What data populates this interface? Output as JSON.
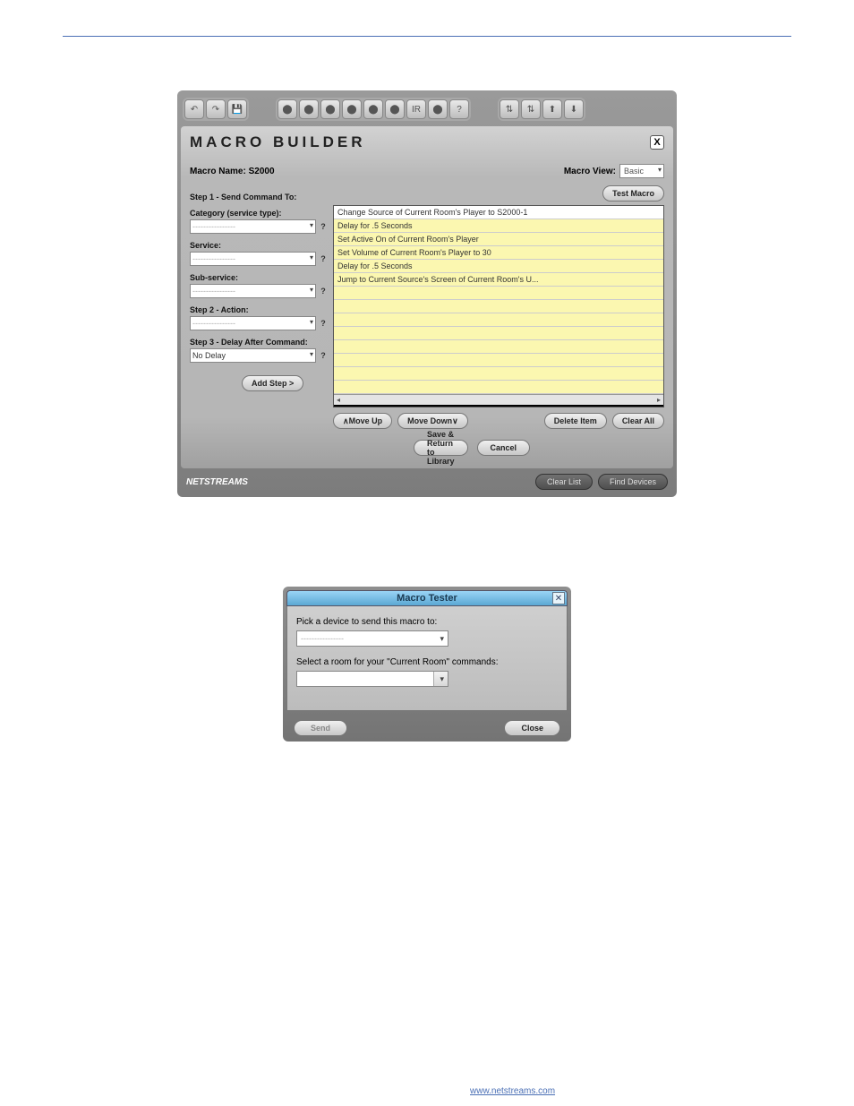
{
  "macro_builder": {
    "title": "MACRO BUILDER",
    "macro_name_label": "Macro Name:",
    "macro_name_value": "S2000",
    "macro_view_label": "Macro View:",
    "macro_view_value": "Basic",
    "test_macro": "Test Macro",
    "step1_label": "Step 1 - Send Command To:",
    "category_label": "Category (service type):",
    "service_label": "Service:",
    "subservice_label": "Sub-service:",
    "step2_label": "Step 2 - Action:",
    "step3_label": "Step 3 - Delay After Command:",
    "delay_value": "No Delay",
    "placeholder": "----------------",
    "add_step": "Add Step  >",
    "steps": [
      "Change Source of Current Room's Player to S2000-1",
      "Delay for .5 Seconds",
      "Set Active On of Current Room's Player",
      "Set Volume of Current Room's Player to 30",
      "Delay for .5 Seconds",
      "Jump to Current Source's Screen of Current Room's U..."
    ],
    "move_up": "Move Up",
    "move_down": "Move Down",
    "delete_item": "Delete Item",
    "clear_all": "Clear All",
    "save_return": "Save & Return to Library",
    "cancel": "Cancel",
    "clear_list": "Clear List",
    "find_devices": "Find Devices",
    "logo": "NETSTREAMS",
    "toolbar_icons": [
      "undo",
      "redo",
      "save",
      "g1",
      "g2",
      "g3",
      "g4",
      "g5",
      "g6",
      "ir",
      "g7",
      "help",
      "n1",
      "n2",
      "n3",
      "n4"
    ],
    "help_marker": "?"
  },
  "macro_tester": {
    "title": "Macro Tester",
    "pick_label": "Pick a device to send this macro to:",
    "room_label": "Select a room for your \"Current Room\" commands:",
    "placeholder": "----------------",
    "send": "Send",
    "close": "Close"
  },
  "bottom_link": "www.netstreams.com"
}
